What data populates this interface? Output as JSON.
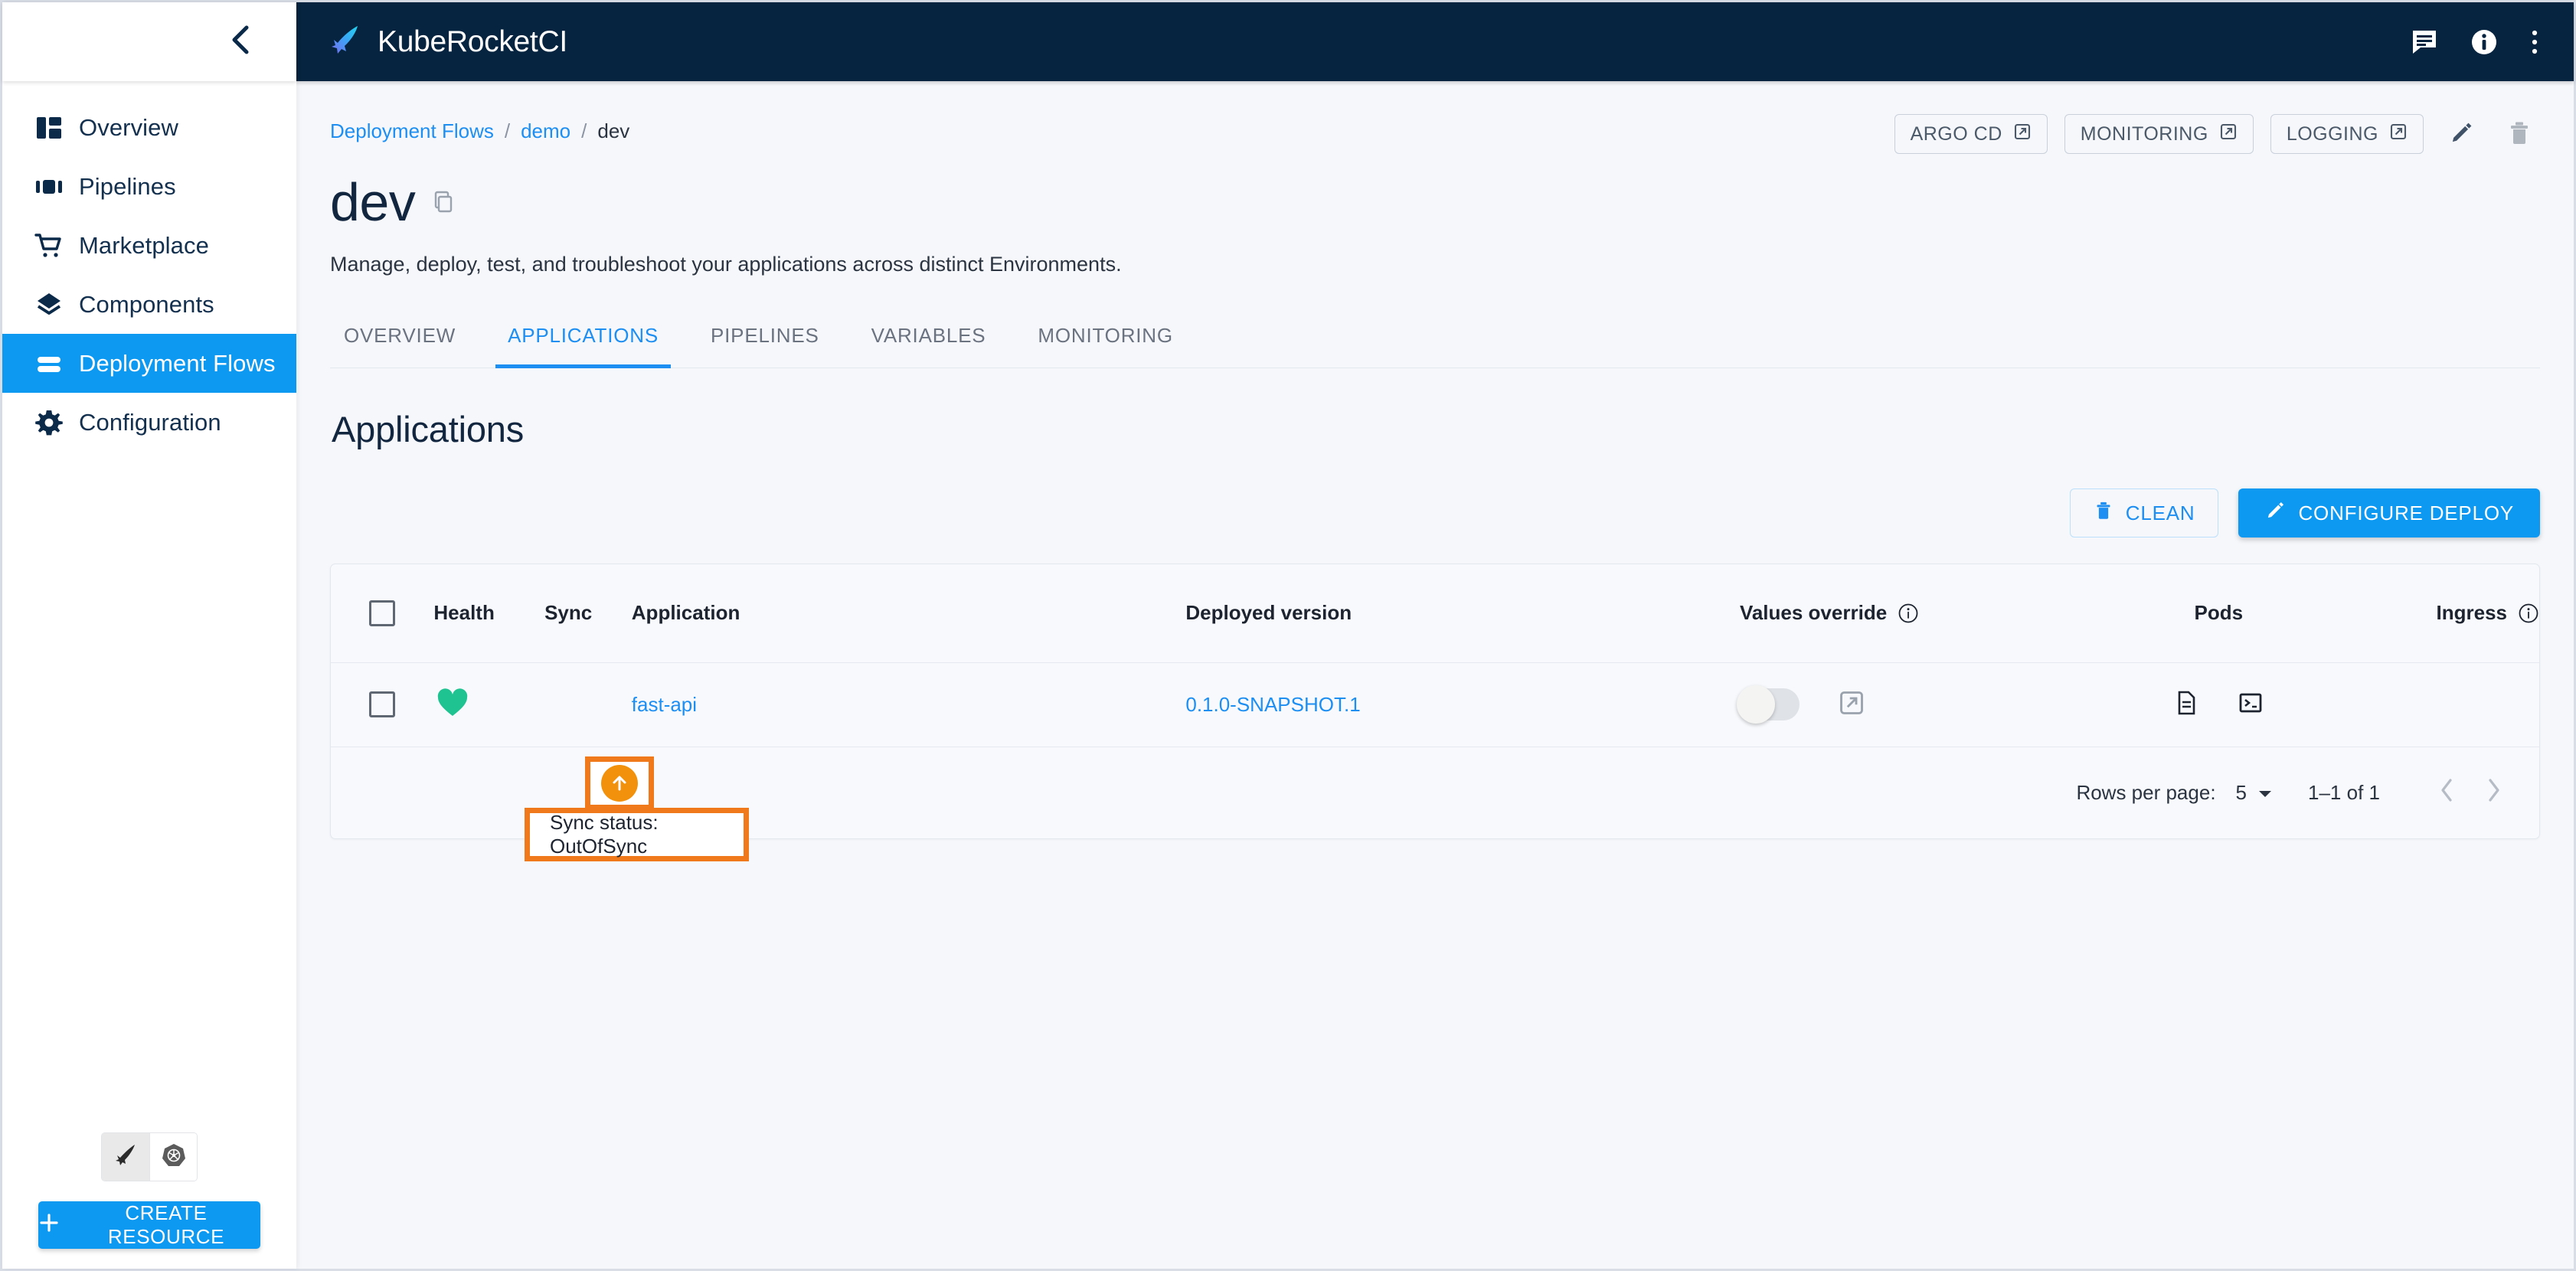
{
  "app": {
    "brand_title": "KubeRocketCI",
    "logo_icon": "rocket-feather-icon"
  },
  "sidebar": {
    "collapse_icon": "chevron-left-icon",
    "items": [
      {
        "label": "Overview",
        "icon": "dashboard-icon",
        "active": false
      },
      {
        "label": "Pipelines",
        "icon": "pipelines-icon",
        "active": false
      },
      {
        "label": "Marketplace",
        "icon": "cart-icon",
        "active": false
      },
      {
        "label": "Components",
        "icon": "layers-icon",
        "active": false
      },
      {
        "label": "Deployment Flows",
        "icon": "deployment-flows-icon",
        "active": true
      },
      {
        "label": "Configuration",
        "icon": "gear-icon",
        "active": false
      }
    ],
    "cluster_switch": [
      {
        "icon": "krci-logo-icon",
        "selected": true
      },
      {
        "icon": "kubernetes-icon",
        "selected": false
      }
    ],
    "create_resource_label": "CREATE RESOURCE",
    "create_resource_icon": "plus-icon"
  },
  "topbar": {
    "icons": [
      {
        "name": "chat-icon"
      },
      {
        "name": "info-icon"
      },
      {
        "name": "more-vertical-icon"
      }
    ]
  },
  "breadcrumb": {
    "items": [
      {
        "label": "Deployment Flows",
        "link": true
      },
      {
        "label": "demo",
        "link": true
      },
      {
        "label": "dev",
        "link": false
      }
    ],
    "separator": "/"
  },
  "header_actions": {
    "buttons": [
      {
        "label": "ARGO CD",
        "icon": "external-link-icon"
      },
      {
        "label": "MONITORING",
        "icon": "external-link-icon"
      },
      {
        "label": "LOGGING",
        "icon": "external-link-icon"
      }
    ],
    "edit_icon": "pencil-icon",
    "delete_icon": "trash-icon"
  },
  "page": {
    "title": "dev",
    "copy_icon": "copy-icon",
    "description": "Manage, deploy, test, and troubleshoot your applications across distinct Environments."
  },
  "tabs": [
    {
      "label": "OVERVIEW",
      "active": false
    },
    {
      "label": "APPLICATIONS",
      "active": true
    },
    {
      "label": "PIPELINES",
      "active": false
    },
    {
      "label": "VARIABLES",
      "active": false
    },
    {
      "label": "MONITORING",
      "active": false
    }
  ],
  "section": {
    "title": "Applications",
    "clean_label": "CLEAN",
    "clean_icon": "trash-icon",
    "deploy_label": "CONFIGURE DEPLOY",
    "deploy_icon": "pencil-icon"
  },
  "table": {
    "columns": [
      {
        "key": "checkbox",
        "label": "",
        "icon": "checkbox-icon"
      },
      {
        "key": "health",
        "label": "Health"
      },
      {
        "key": "sync",
        "label": "Sync"
      },
      {
        "key": "application",
        "label": "Application"
      },
      {
        "key": "version",
        "label": "Deployed version"
      },
      {
        "key": "values_override",
        "label": "Values override",
        "info_icon": "info-circle-icon"
      },
      {
        "key": "pods",
        "label": "Pods"
      },
      {
        "key": "ingress",
        "label": "Ingress",
        "info_icon": "info-circle-icon"
      }
    ],
    "rows": [
      {
        "selected": false,
        "health_icon": "heart-icon",
        "health_color": "#1fc391",
        "sync_icon": "arrow-up-circle-icon",
        "sync_color": "#f2920c",
        "application": "fast-api",
        "version": "0.1.0-SNAPSHOT.1",
        "values_override_on": false,
        "values_override_link_icon": "external-link-icon",
        "pods_icons": [
          "document-icon",
          "terminal-icon"
        ],
        "ingress": ""
      }
    ]
  },
  "pagination": {
    "rows_per_page_label": "Rows per page:",
    "rows_per_page_value": "5",
    "dropdown_icon": "caret-down-icon",
    "range_label": "1–1 of 1",
    "prev_icon": "chevron-left-icon",
    "next_icon": "chevron-right-icon"
  },
  "highlight": {
    "accent_color": "#f07a1b",
    "tooltip_text": "Sync status: OutOfSync"
  }
}
